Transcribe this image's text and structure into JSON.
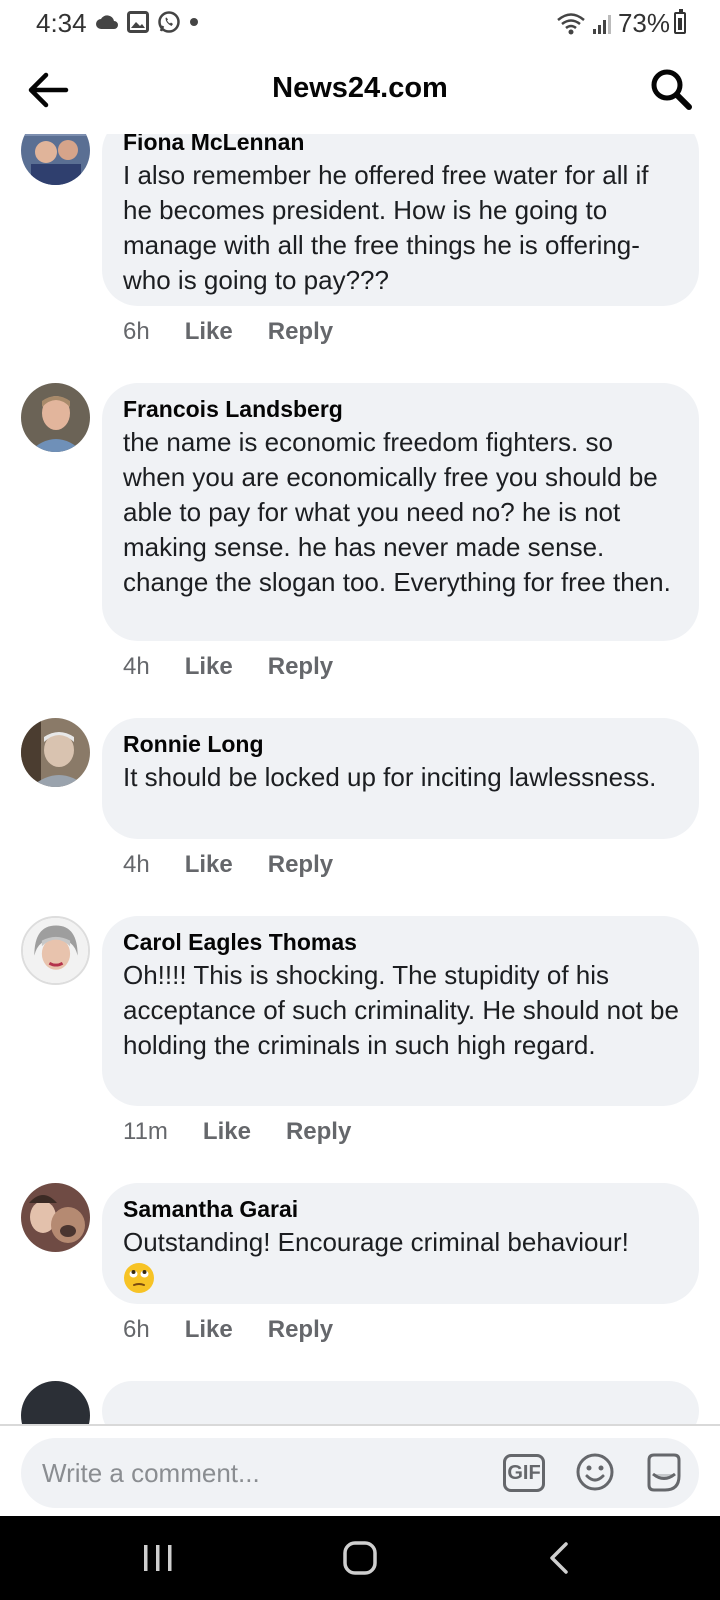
{
  "status": {
    "time": "4:34",
    "battery": "73%"
  },
  "header": {
    "title": "News24.com"
  },
  "comments": [
    {
      "author": "Fiona McLennan",
      "text": "I also remember he offered free water for all if he becomes president. How is he going to manage with all the free things he is offering- who is going to pay???",
      "time": "6h",
      "like": "Like",
      "reply": "Reply"
    },
    {
      "author": "Francois Landsberg",
      "text": "the name is economic freedom fighters. so when you are economically free you should be able to pay for what you need no? he is not making sense. he has never made sense. change the slogan too. Everything for free then.",
      "time": "4h",
      "like": "Like",
      "reply": "Reply"
    },
    {
      "author": "Ronnie Long",
      "text": "It should be locked up for inciting lawlessness.",
      "time": "4h",
      "like": "Like",
      "reply": "Reply"
    },
    {
      "author": "Carol Eagles Thomas",
      "text": "Oh!!!! This is shocking. The stupidity of his acceptance of such criminality. He should not be holding the criminals in such high regard.",
      "time": "11m",
      "like": "Like",
      "reply": "Reply"
    },
    {
      "author": "Samantha Garai",
      "text": "Outstanding! Encourage criminal behaviour!",
      "time": "6h",
      "like": "Like",
      "reply": "Reply"
    }
  ],
  "composer": {
    "placeholder": "Write a comment...",
    "gif_label": "GIF"
  },
  "colors": {
    "bubble": "#f0f2f5",
    "meta_text": "#65676b"
  }
}
